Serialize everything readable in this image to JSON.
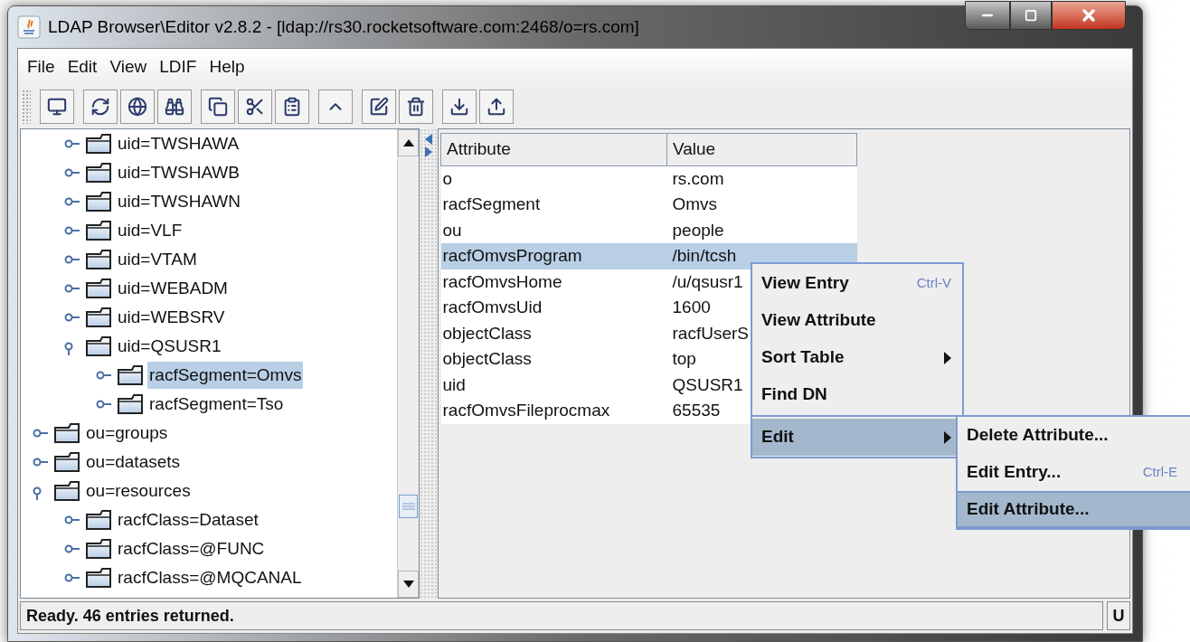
{
  "window": {
    "title": "LDAP Browser\\Editor v2.8.2 - [ldap://rs30.rocketsoftware.com:2468/o=rs.com]"
  },
  "menu_bar": [
    {
      "label": "File"
    },
    {
      "label": "Edit"
    },
    {
      "label": "View"
    },
    {
      "label": "LDIF"
    },
    {
      "label": "Help"
    }
  ],
  "toolbar": [
    [
      {
        "kind": "computer"
      }
    ],
    [
      {
        "kind": "refresh"
      },
      {
        "kind": "globe"
      },
      {
        "kind": "binoculars"
      }
    ],
    [
      {
        "kind": "copy"
      },
      {
        "kind": "cut"
      },
      {
        "kind": "paste"
      }
    ],
    [
      {
        "kind": "up"
      }
    ],
    [
      {
        "kind": "edit"
      },
      {
        "kind": "delete"
      }
    ],
    [
      {
        "kind": "import"
      },
      {
        "kind": "export"
      }
    ]
  ],
  "tree": [
    {
      "children": [
        {
          "label": "uid=TWSHAWA",
          "expanded": false,
          "selected": false
        },
        {
          "label": "uid=TWSHAWB",
          "expanded": false,
          "selected": false
        },
        {
          "label": "uid=TWSHAWN",
          "expanded": false,
          "selected": false
        },
        {
          "label": "uid=VLF",
          "expanded": false,
          "selected": false
        },
        {
          "label": "uid=VTAM",
          "expanded": false,
          "selected": false
        },
        {
          "label": "uid=WEBADM",
          "expanded": false,
          "selected": false
        },
        {
          "label": "uid=WEBSRV",
          "expanded": false,
          "selected": false
        },
        {
          "label": "uid=QSUSR1",
          "expanded": true,
          "selected": false,
          "children": [
            {
              "label": "racfSegment=Omvs",
              "expanded": false,
              "selected": true
            },
            {
              "label": "racfSegment=Tso",
              "expanded": false,
              "selected": false
            }
          ]
        }
      ]
    },
    {
      "label": "ou=groups",
      "expanded": false,
      "selected": false
    },
    {
      "label": "ou=datasets",
      "expanded": false,
      "selected": false
    },
    {
      "label": "ou=resources",
      "expanded": true,
      "selected": false,
      "children": [
        {
          "label": "racfClass=Dataset",
          "expanded": false,
          "selected": false
        },
        {
          "label": "racfClass=@FUNC",
          "expanded": false,
          "selected": false
        },
        {
          "label": "racfClass=@MQCANAL",
          "expanded": false,
          "selected": false
        }
      ]
    }
  ],
  "table": {
    "columns": [
      "Attribute",
      "Value"
    ],
    "rows": [
      {
        "cells": [
          "o",
          "rs.com"
        ],
        "selected": false
      },
      {
        "cells": [
          "racfSegment",
          "Omvs"
        ],
        "selected": false
      },
      {
        "cells": [
          "ou",
          "people"
        ],
        "selected": false
      },
      {
        "cells": [
          "racfOmvsProgram",
          "/bin/tcsh"
        ],
        "selected": true
      },
      {
        "cells": [
          "racfOmvsHome",
          "/u/qsusr1"
        ],
        "selected": false
      },
      {
        "cells": [
          "racfOmvsUid",
          "1600"
        ],
        "selected": false
      },
      {
        "cells": [
          "objectClass",
          "racfUserS"
        ],
        "selected": false
      },
      {
        "cells": [
          "objectClass",
          "top"
        ],
        "selected": false
      },
      {
        "cells": [
          "uid",
          "QSUSR1"
        ],
        "selected": false
      },
      {
        "cells": [
          "racfOmvsFileprocmax",
          "65535"
        ],
        "selected": false
      }
    ]
  },
  "context_menu": {
    "items": [
      {
        "kind": "item",
        "label": "View Entry",
        "shortcut": "Ctrl-V",
        "submenu": false,
        "selected": false
      },
      {
        "kind": "item",
        "label": "View Attribute",
        "submenu": false,
        "selected": false
      },
      {
        "kind": "item",
        "label": "Sort Table",
        "submenu": true,
        "selected": false
      },
      {
        "kind": "item",
        "label": "Find DN",
        "submenu": false,
        "selected": false
      },
      {
        "kind": "separator"
      },
      {
        "kind": "item",
        "label": "Edit",
        "submenu": true,
        "selected": true
      }
    ]
  },
  "submenu": {
    "items": [
      {
        "label": "Delete Attribute...",
        "selected": false
      },
      {
        "label": "Edit Entry...",
        "shortcut": "Ctrl-E",
        "selected": false
      },
      {
        "label": "Edit Attribute...",
        "selected": true
      }
    ]
  },
  "status_bar": {
    "message": "Ready. 46 entries returned.",
    "indicator": "U"
  }
}
